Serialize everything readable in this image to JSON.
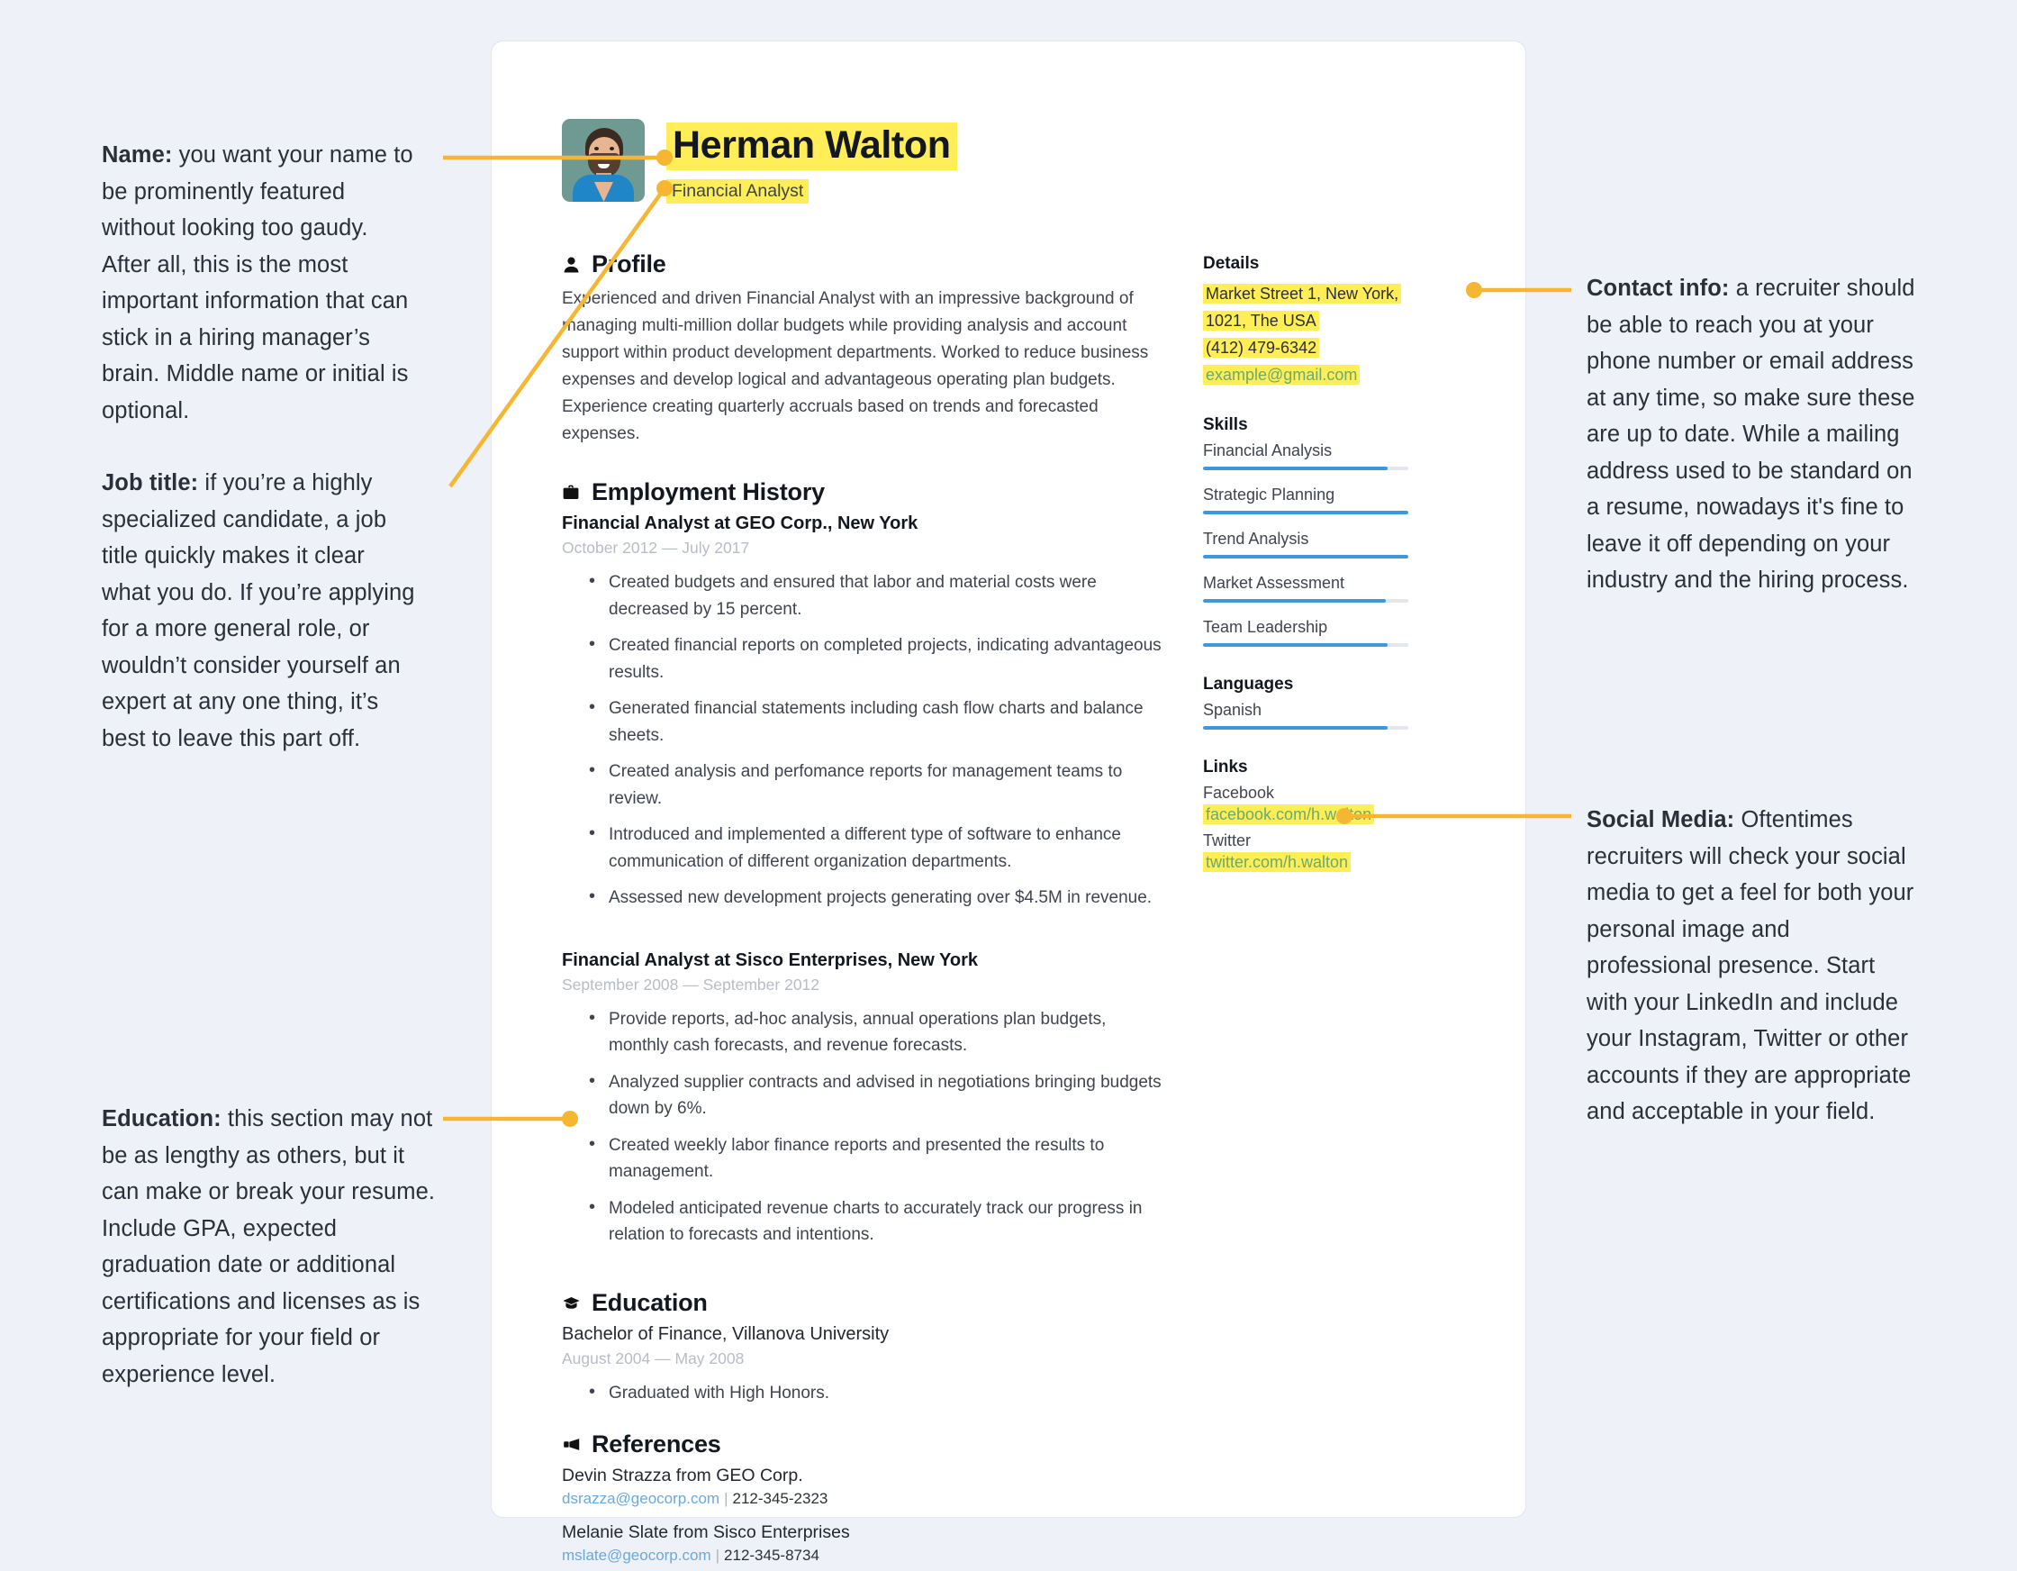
{
  "annotations": {
    "name": {
      "lead": "Name:",
      "body": " you want your name to be prominently featured without looking too gaudy. After all, this is the most important information that can stick in a hiring manager’s brain. Middle name or initial is optional."
    },
    "job_title": {
      "lead": "Job title:",
      "body": " if you’re a highly specialized candidate, a job title quickly makes it clear what you do. If you’re applying for a more general role, or wouldn’t consider yourself an expert at any one thing, it’s best to leave this part off."
    },
    "education": {
      "lead": "Education:",
      "body": " this section may not be as lengthy as others, but it can make or break your resume. Include GPA, expected graduation date or additional certifications and licenses as is appropriate for your field or experience level."
    },
    "contact_info": {
      "lead": "Contact info:",
      "body": " a recruiter should be able to reach you at your phone number or email address at any time, so make sure these are up to date. While a mailing address used to be standard on a resume, nowadays it's fine to leave it off depending on your industry and the hiring process."
    },
    "social_media": {
      "lead": "Social Media:",
      "body": " Oftentimes recruiters will check your social media to get a feel for both your personal image and professional presence. Start with your LinkedIn and include your Instagram, Twitter or other accounts if they are appropriate and acceptable in your field."
    }
  },
  "resume": {
    "name": "Herman Walton",
    "job_title": "Financial Analyst",
    "profile": {
      "title": "Profile",
      "icon": "person-icon",
      "text": "Experienced and driven Financial Analyst with an impressive background of managing multi-million dollar budgets while providing analysis and account support within product development departments. Worked to reduce business expenses and develop logical and advantageous operating plan budgets. Experience creating quarterly accruals based on trends and forecasted expenses."
    },
    "employment": {
      "title": "Employment History",
      "icon": "briefcase-icon",
      "jobs": [
        {
          "heading": "Financial Analyst at GEO Corp., New York",
          "dates": "October 2012 — July 2017",
          "bullets": [
            "Created budgets and ensured that labor and material costs were decreased by 15 percent.",
            "Created financial reports on completed projects, indicating advantageous results.",
            "Generated financial statements including cash flow charts and balance sheets.",
            "Created analysis and perfomance reports for management teams to review.",
            "Introduced and implemented a different type of software to enhance communication of different organization departments.",
            "Assessed new development projects generating over $4.5M in revenue."
          ]
        },
        {
          "heading": "Financial Analyst at Sisco Enterprises, New York",
          "dates": "September 2008 — September 2012",
          "bullets": [
            "Provide reports, ad-hoc analysis, annual operations plan budgets, monthly cash forecasts, and revenue forecasts.",
            "Analyzed supplier contracts and advised in negotiations bringing budgets down by 6%.",
            "Created weekly labor finance reports and presented the results to management.",
            "Modeled anticipated revenue charts to accurately track our progress in relation to forecasts and intentions."
          ]
        }
      ]
    },
    "education": {
      "title": "Education",
      "icon": "graduation-cap-icon",
      "degree": "Bachelor of Finance, Villanova University",
      "dates": "August 2004 — May 2008",
      "bullets": [
        "Graduated with High Honors."
      ]
    },
    "references": {
      "title": "References",
      "icon": "megaphone-icon",
      "items": [
        {
          "name": "Devin Strazza from GEO Corp.",
          "email": "dsrazza@geocorp.com",
          "separator": "|",
          "phone": "212-345-2323"
        },
        {
          "name": "Melanie Slate from Sisco Enterprises",
          "email": "mslate@geocorp.com",
          "separator": "|",
          "phone": "212-345-8734"
        }
      ]
    },
    "details": {
      "title": "Details",
      "address_line1": "Market Street 1, New York,",
      "address_line2": "1021, The USA",
      "phone": "(412) 479-6342",
      "email": "example@gmail.com"
    },
    "skills": {
      "title": "Skills",
      "items": [
        {
          "label": "Financial Analysis",
          "level": 90
        },
        {
          "label": "Strategic Planning",
          "level": 100
        },
        {
          "label": "Trend Analysis",
          "level": 100
        },
        {
          "label": "Market Assessment",
          "level": 89
        },
        {
          "label": "Team Leadership",
          "level": 90
        }
      ]
    },
    "languages": {
      "title": "Languages",
      "items": [
        {
          "label": "Spanish",
          "level": 90
        }
      ]
    },
    "links": {
      "title": "Links",
      "items": [
        {
          "label": "Facebook",
          "url": "facebook.com/h.walton"
        },
        {
          "label": "Twitter",
          "url": "twitter.com/h.walton"
        }
      ]
    }
  },
  "colors": {
    "page_background": "#eef1f7",
    "card_background": "#ffffff",
    "highlight": "#ffee58",
    "connector": "#f5b731",
    "skill_bar": "#3f97de",
    "skill_track": "#e3e6ea",
    "link_green": "#6aaa6e",
    "email_blue": "#6aa9dd"
  }
}
